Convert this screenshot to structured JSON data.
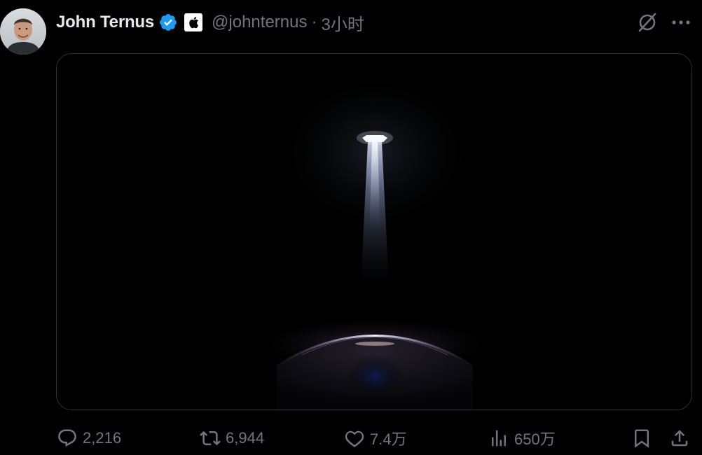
{
  "author": {
    "display_name": "John Ternus",
    "handle": "@johnternus",
    "separator": "·",
    "timestamp": "3小时",
    "verified_color": "#1d9bf0"
  },
  "header_icons": {
    "grok": "grok-slash-icon",
    "more": "more-horizontal-icon"
  },
  "media": {
    "type": "image",
    "description_icon": "spotlight-image"
  },
  "actions": {
    "reply_count": "2,216",
    "retweet_count": "6,944",
    "like_count": "7.4万",
    "views_count": "650万"
  },
  "colors": {
    "background": "#000000",
    "primary_text": "#e7e9ea",
    "secondary_text": "#71767b",
    "border": "#2f3336"
  }
}
